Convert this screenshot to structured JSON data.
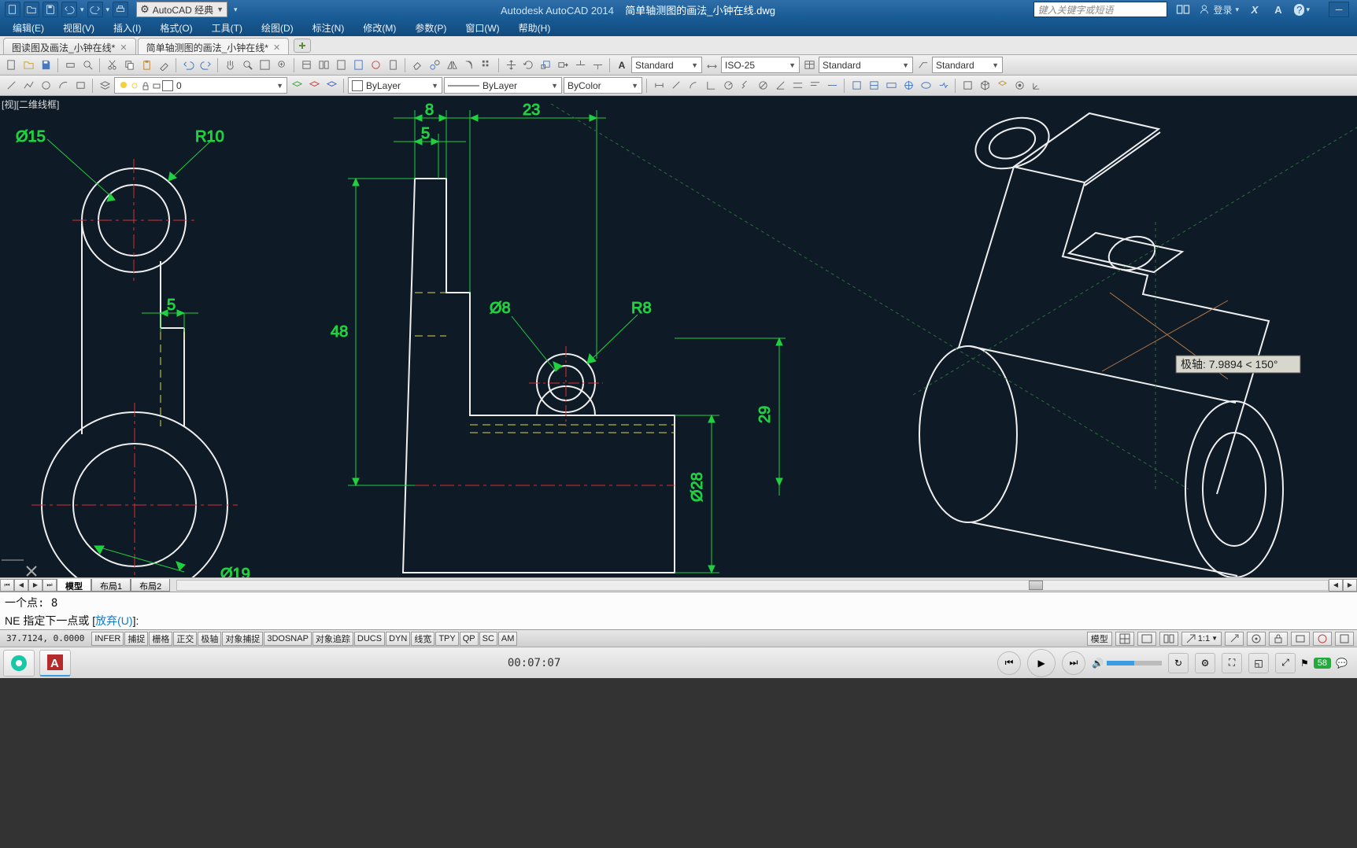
{
  "titlebar": {
    "workspace": "AutoCAD 经典",
    "app": "Autodesk AutoCAD 2014",
    "doc": "简单轴测图的画法_小钟在线.dwg",
    "search_placeholder": "键入关键字或短语",
    "login_label": "登录",
    "x_icon": "X",
    "a_icon": "A",
    "help_icon": "?"
  },
  "menus": [
    "编辑(E)",
    "视图(V)",
    "插入(I)",
    "格式(O)",
    "工具(T)",
    "绘图(D)",
    "标注(N)",
    "修改(M)",
    "参数(P)",
    "窗口(W)",
    "帮助(H)"
  ],
  "doctabs": [
    {
      "label": "图读图及画法_小钟在线*",
      "active": false
    },
    {
      "label": "简单轴测图的画法_小钟在线*",
      "active": true
    }
  ],
  "toolbar1": {
    "dd_style": "Standard",
    "dd_dim": "ISO-25",
    "dd_table": "Standard",
    "dd_mleader": "Standard"
  },
  "toolbar2": {
    "layer": "0",
    "prop1": "ByLayer",
    "prop2": "ByLayer",
    "prop3": "ByColor"
  },
  "view_label": "[视][二维线框]",
  "layout_tabs": [
    "模型",
    "布局1",
    "布局2"
  ],
  "command": {
    "history": "一个点:  8",
    "prompt_head": "NE 指定下一点或 [",
    "prompt_undo": "放弃(U)",
    "prompt_tail": "]:"
  },
  "statusbar": {
    "coords": "37.7124, 0.0000",
    "toggles": [
      "INFER",
      "捕捉",
      "栅格",
      "正交",
      "极轴",
      "对象捕捉",
      "3DOSNAP",
      "对象追踪",
      "DUCS",
      "DYN",
      "线宽",
      "TPY",
      "QP",
      "SC",
      "AM"
    ],
    "right_model": "模型",
    "right_scale": "1:1",
    "right_tray": "58"
  },
  "drawing": {
    "dims": {
      "d15": "Ø15",
      "r10": "R10",
      "w5a": "5",
      "w8": "8",
      "w5b": "5",
      "w23": "23",
      "h48": "48",
      "d8": "Ø8",
      "r8": "R8",
      "d28": "Ø28",
      "h29": "29",
      "d19": "Ø19"
    },
    "tooltip": "极轴: 7.9894 < 150°"
  },
  "taskbar": {
    "clock": "00:07:07",
    "tray_num": "58"
  }
}
